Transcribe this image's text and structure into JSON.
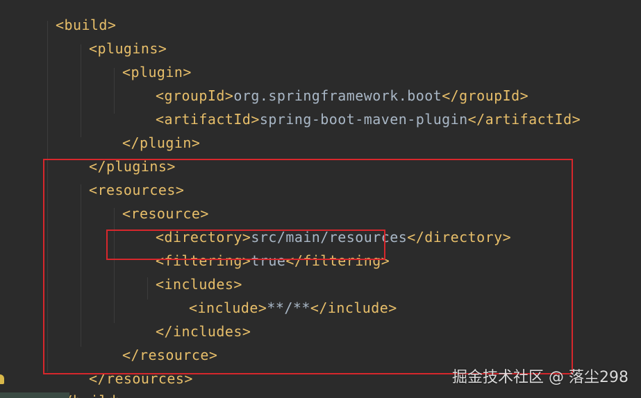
{
  "editor": {
    "colors": {
      "background": "#2b2b2b",
      "tag": "#e8bf6a",
      "text": "#a9b7c6",
      "highlight_box": "#d8272c"
    },
    "lines": [
      {
        "tag_open": "<build>"
      },
      {
        "tag_open": "<plugins>"
      },
      {
        "tag_open": "<plugin>"
      },
      {
        "tag_open": "<groupId>",
        "value": "org.springframework.boot",
        "tag_close": "</groupId>"
      },
      {
        "tag_open": "<artifactId>",
        "value": "spring-boot-maven-plugin",
        "tag_close": "</artifactId>"
      },
      {
        "tag_open": "</plugin>"
      },
      {
        "tag_open": "</plugins>"
      },
      {
        "tag_open": "<resources>"
      },
      {
        "tag_open": "<resource>"
      },
      {
        "tag_open": "<directory>",
        "value": "src/main/resources",
        "tag_close": "</directory>"
      },
      {
        "tag_open": "<filtering>",
        "value": "true",
        "tag_close": "</filtering>"
      },
      {
        "tag_open": "<includes>"
      },
      {
        "tag_open": "<include>",
        "value": "**/**",
        "tag_close": "</include>"
      },
      {
        "tag_open": "</includes>"
      },
      {
        "tag_open": "</resource>"
      },
      {
        "tag_open": "</resources>"
      },
      {
        "tag_open": "</build>"
      }
    ],
    "gutter_icon": "bulb-icon"
  },
  "watermark": {
    "text": "掘金技术社区 @ 落尘298"
  }
}
